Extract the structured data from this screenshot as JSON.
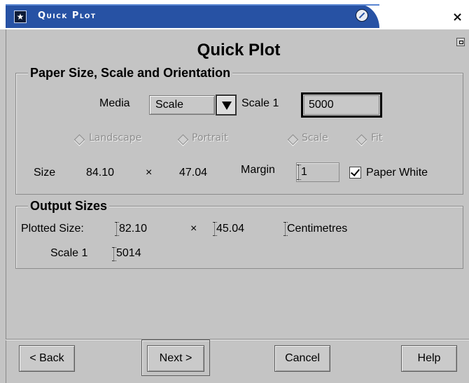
{
  "window": {
    "title": "Quick Plot",
    "icons": {
      "window_menu": "star-icon",
      "shade": "shade-icon",
      "close": "close-icon"
    }
  },
  "dialog": {
    "title": "Quick Plot"
  },
  "paper_group": {
    "label": "Paper Size, Scale and Orientation",
    "media_label": "Media",
    "media_value": "Scale",
    "scale_label": "Scale 1",
    "scale_value": "5000",
    "orientation_options": [
      "Landscape",
      "Portrait"
    ],
    "fit_options": [
      "Scale",
      "Fit"
    ],
    "size_label": "Size",
    "size_width": "84.10",
    "size_x": "×",
    "size_height": "47.04",
    "margin_label": "Margin",
    "margin_value": "1",
    "paper_white_label": "Paper White",
    "paper_white_checked": true
  },
  "output_group": {
    "label": "Output Sizes",
    "plotted_label": "Plotted Size:",
    "plotted_width": "82.10",
    "plotted_x": "×",
    "plotted_height": "45.04",
    "units": "Centimetres",
    "scale_label": "Scale 1",
    "scale_value": "5014"
  },
  "buttons": {
    "back": "< Back",
    "next": "Next >",
    "cancel": "Cancel",
    "help": "Help"
  },
  "colors": {
    "titlebar": "#2752a4",
    "dialog_bg": "#c4c4c4"
  }
}
